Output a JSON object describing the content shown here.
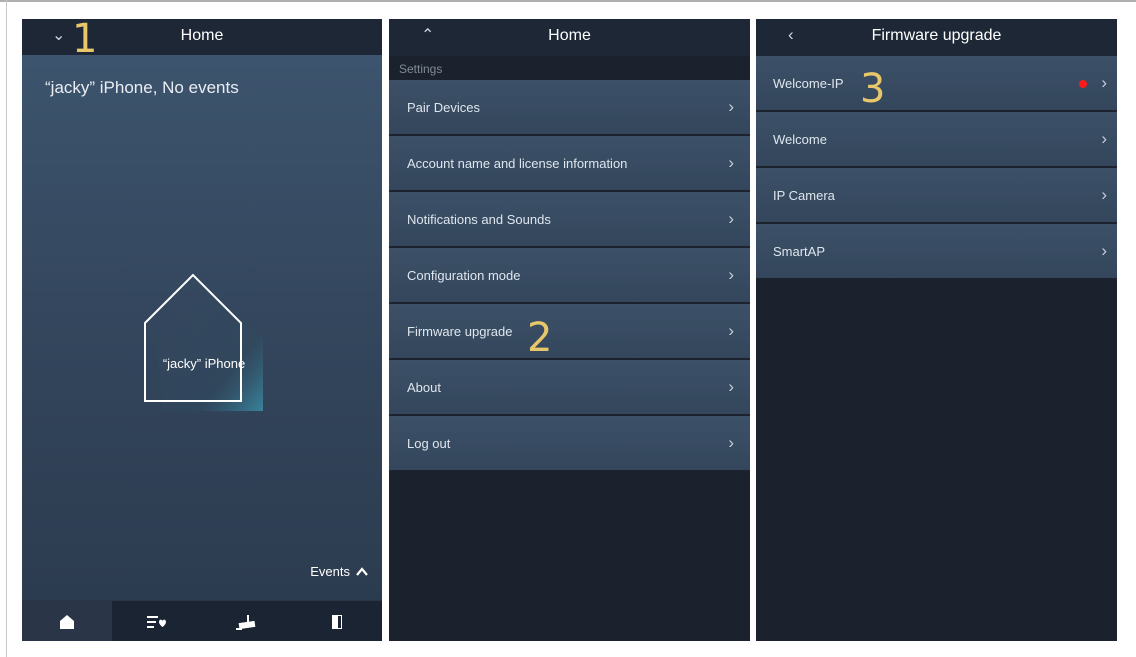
{
  "annotations": {
    "step1": "1",
    "step2": "2",
    "step3": "3"
  },
  "screen1": {
    "header": {
      "title": "Home"
    },
    "status_text": "“jacky” iPhone, No events",
    "house_label": "“jacky” iPhone",
    "events_label": "Events",
    "tabs": [
      {
        "icon": "home-icon"
      },
      {
        "icon": "event-list-icon"
      },
      {
        "icon": "camera-icon"
      },
      {
        "icon": "door-icon"
      }
    ]
  },
  "screen2": {
    "header": {
      "title": "Home"
    },
    "section_label": "Settings",
    "items": [
      {
        "label": "Pair Devices"
      },
      {
        "label": "Account name and license information"
      },
      {
        "label": "Notifications and Sounds"
      },
      {
        "label": "Configuration mode"
      },
      {
        "label": "Firmware upgrade"
      },
      {
        "label": "About"
      },
      {
        "label": "Log out"
      }
    ]
  },
  "screen3": {
    "header": {
      "title": "Firmware upgrade"
    },
    "items": [
      {
        "label": "Welcome-IP",
        "update_available": true
      },
      {
        "label": "Welcome"
      },
      {
        "label": "IP Camera"
      },
      {
        "label": "SmartAP"
      }
    ]
  },
  "colors": {
    "header_bg": "#1d2736",
    "row_bg": "#3c5067",
    "annotation": "#e8c76a",
    "update_dot": "#ff1a1a"
  }
}
